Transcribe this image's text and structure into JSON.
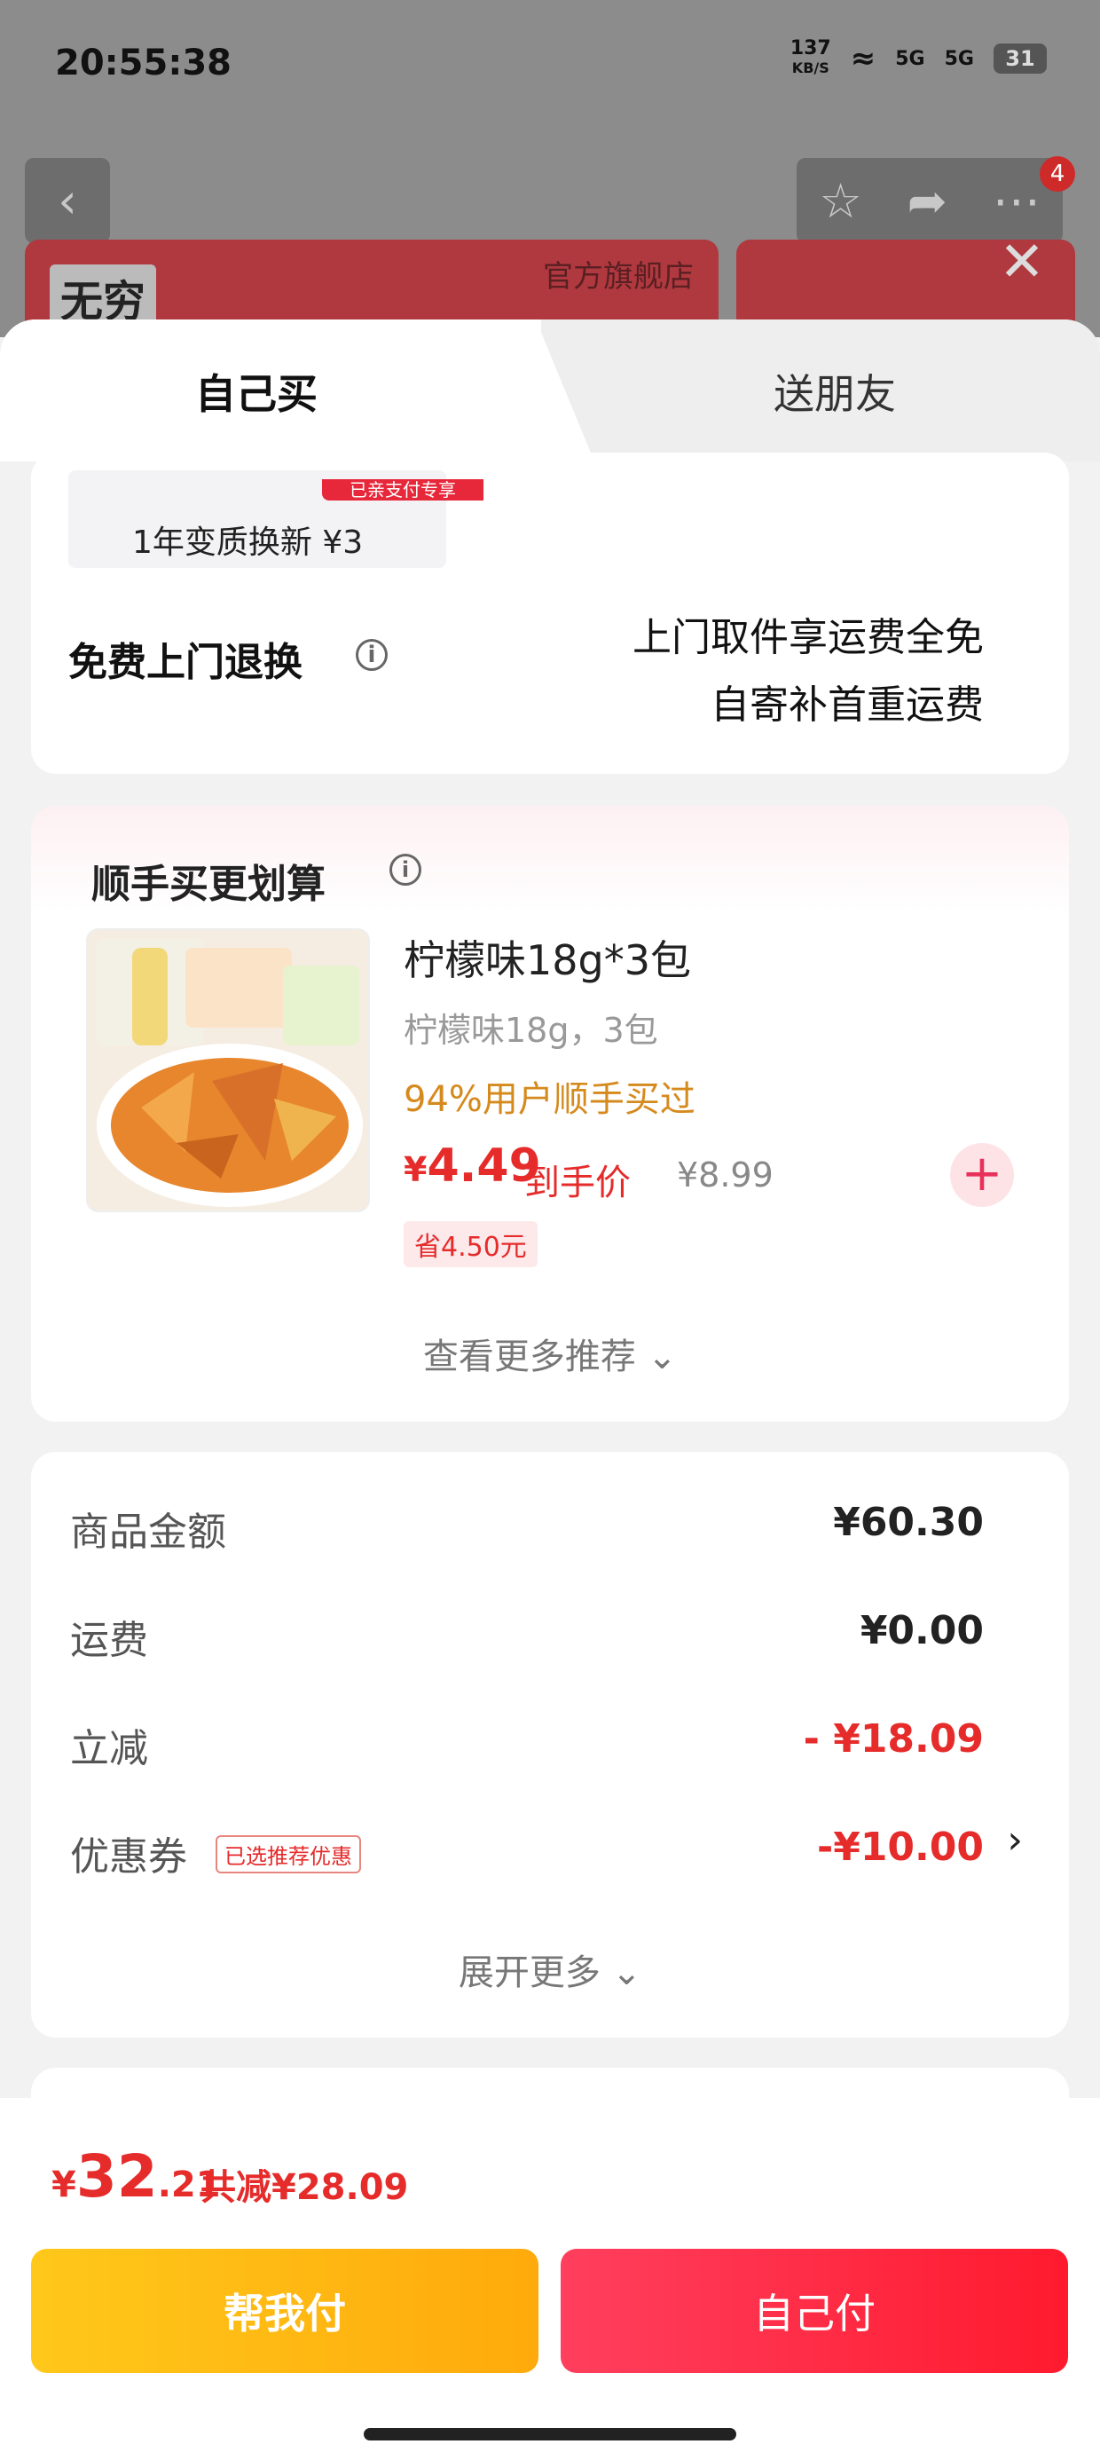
{
  "status_bar": {
    "time": "20:55:38",
    "speed_value": "137",
    "speed_unit": "KB/S",
    "signal_1": "5G",
    "signal_2": "5G",
    "battery": "31"
  },
  "background_page": {
    "badge_count": "4",
    "brand_logo": "无穷",
    "store_label": "官方旗舰店"
  },
  "tabs": {
    "self_buy": "自己买",
    "gift_friend": "送朋友"
  },
  "service": {
    "renew_tag": "已亲支付专享",
    "renew_option": "1年变质换新 ¥3",
    "return_title": "免费上门退换",
    "return_line_1": "上门取件享运费全免",
    "return_line_2": "自寄补首重运费"
  },
  "addon": {
    "title": "顺手买更划算",
    "product_name": "柠檬味18g*3包",
    "product_spec": "柠檬味18g，3包",
    "social_proof": "94%用户顺手买过",
    "price_currency": "¥",
    "price_value": "4.49",
    "price_label": "到手价",
    "original_price": "¥8.99",
    "save_label": "省4.50元",
    "more_label": "查看更多推荐 ⌄"
  },
  "summary": {
    "goods_label": "商品金额",
    "goods_value": "¥60.30",
    "shipping_label": "运费",
    "shipping_value": "¥0.00",
    "discount_label": "立减",
    "discount_value": "- ¥18.09",
    "coupon_label": "优惠券",
    "coupon_tag": "已选推荐优惠",
    "coupon_value": "-¥10.00",
    "expand_label": "展开更多 ⌄"
  },
  "bottom": {
    "total_currency": "¥",
    "total_int": "32",
    "total_dec": ".21",
    "total_saved": "共减¥28.09",
    "pay_help_label": "帮我付",
    "pay_self_label": "自己付"
  },
  "colors": {
    "accent_red": "#e62b2b",
    "pay_yellow": "#ffb80f",
    "pay_red": "#ff2a40",
    "social_orange": "#d58a1e"
  }
}
